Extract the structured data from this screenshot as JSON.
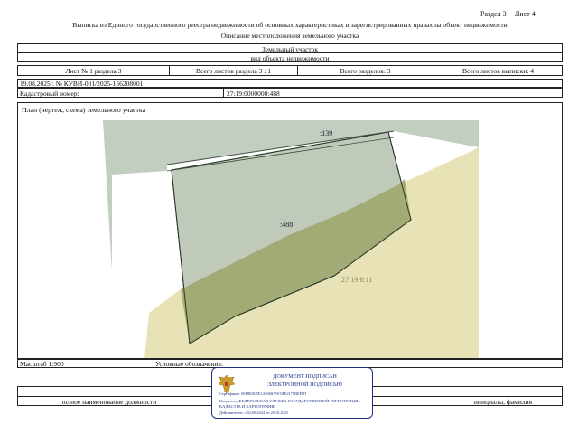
{
  "header": {
    "section": "Раздел 3",
    "sheet": "Лист 4",
    "title": "Выписка из Единого государственного реестра недвижимости об основных характеристиках и зарегистрированных правах на объект недвижимости",
    "subtitle": "Описание местоположения земельного участка"
  },
  "object": {
    "kind": "Земельный участок",
    "kind_caption": "вид объекта недвижимости"
  },
  "sheets": {
    "sheet_no": "Лист № 1 раздела 3",
    "total_section": "Всего листов раздела 3 : 1",
    "total_sections": "Всего разделов: 3",
    "total_extract": "Всего листов выписки: 4"
  },
  "record": {
    "date_no": "19.08.2025г. № КУВИ-001/2025-156208001",
    "cadastral_label": "Кадастровый номер:",
    "cadastral_value": "27:19:0000000:488"
  },
  "plan": {
    "title": "План (чертеж, схема) земельного участка",
    "labels": {
      "parcel_main": ":488",
      "parcel_neighbor": ":139",
      "quarter": "27:19:6:11"
    },
    "colors": {
      "parcel_fill": "#b9c4b4",
      "neighbor_fill": "#bfcbbd",
      "quarter_fill": "#e7e1b3",
      "overlap_fill": "#9ea56a"
    }
  },
  "footer": {
    "scale": "Масштаб 1:900",
    "legend": "Условные обозначения:",
    "position_caption": "полное наименование должности",
    "signature_caption": "инициалы, фамилия"
  },
  "stamp": {
    "line1": "ДОКУМЕНТ ПОДПИСАН",
    "line2": "ЭЛЕКТРОННОЙ ПОДПИСЬЮ",
    "certificate": "Сертификат: 00F8E0C5E1A0368A9C9FE2178BEF6D",
    "owner": "Владелец: ФЕДЕРАЛЬНАЯ СЛУЖБА ГОСУДАРСТВЕННОЙ РЕГИСТРАЦИИ, КАДАСТРА И КАРТОГРАФИИ",
    "valid": "Действителен: с 02.08.2024 по 26.10.2025",
    "emblem_icon": "russian-eagle-emblem-icon"
  }
}
